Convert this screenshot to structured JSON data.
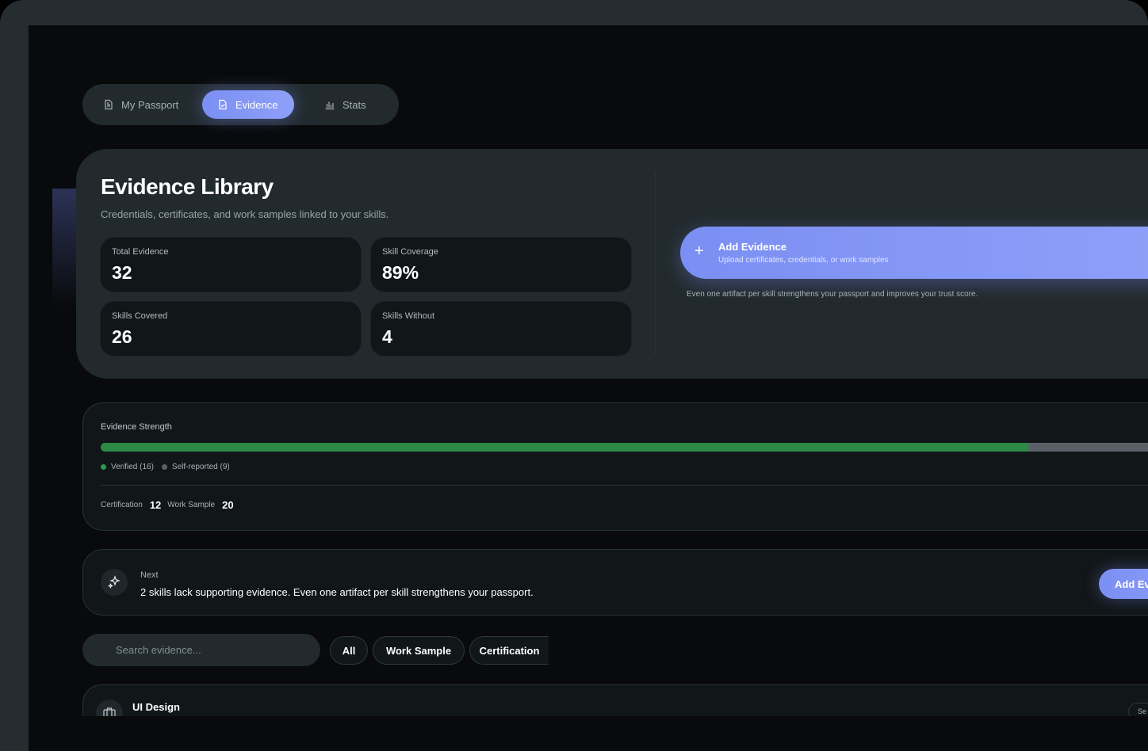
{
  "tabs": [
    {
      "label": "My Passport",
      "icon": "document-icon"
    },
    {
      "label": "Evidence",
      "icon": "file-check-icon",
      "active": true
    },
    {
      "label": "Stats",
      "icon": "bar-chart-icon"
    }
  ],
  "hero": {
    "title": "Evidence Library",
    "subtitle": "Credentials, certificates, and work samples linked to your skills.",
    "stats": [
      {
        "label": "Total Evidence",
        "value": "32"
      },
      {
        "label": "Skill Coverage",
        "value": "89%"
      },
      {
        "label": "Skills Covered",
        "value": "26"
      },
      {
        "label": "Skills Without",
        "value": "4"
      }
    ],
    "add_button": {
      "icon": "plus-icon",
      "title": "Add Evidence",
      "subtitle": "Upload certificates, credentials, or work samples"
    },
    "note": "Even one artifact per skill strengthens your passport and improves your trust score."
  },
  "strength": {
    "title": "Evidence Strength",
    "verified_fraction": 0.86,
    "legend": [
      {
        "label": "Verified (16)",
        "color": "#2c9a4c"
      },
      {
        "label": "Self-reported (9)",
        "color": "#5a6166"
      }
    ],
    "counts": [
      {
        "label": "Certification",
        "value": "12"
      },
      {
        "label": "Work Sample",
        "value": "20"
      }
    ]
  },
  "next": {
    "icon": "sparkle-icon",
    "label": "Next",
    "text": "2 skills lack supporting evidence. Even one artifact per skill strengthens your passport.",
    "button": "Add Ev"
  },
  "filters": {
    "search_placeholder": "Search evidence...",
    "chips": [
      "All",
      "Work Sample",
      "Certification"
    ]
  },
  "items": [
    {
      "icon": "briefcase-icon",
      "title": "UI Design",
      "badge": "Se"
    }
  ],
  "colors": {
    "accent": "#7b8ff3",
    "verified": "#2c9a4c",
    "self_reported": "#5a6166",
    "card": "#222a2e",
    "panel": "#111618"
  }
}
